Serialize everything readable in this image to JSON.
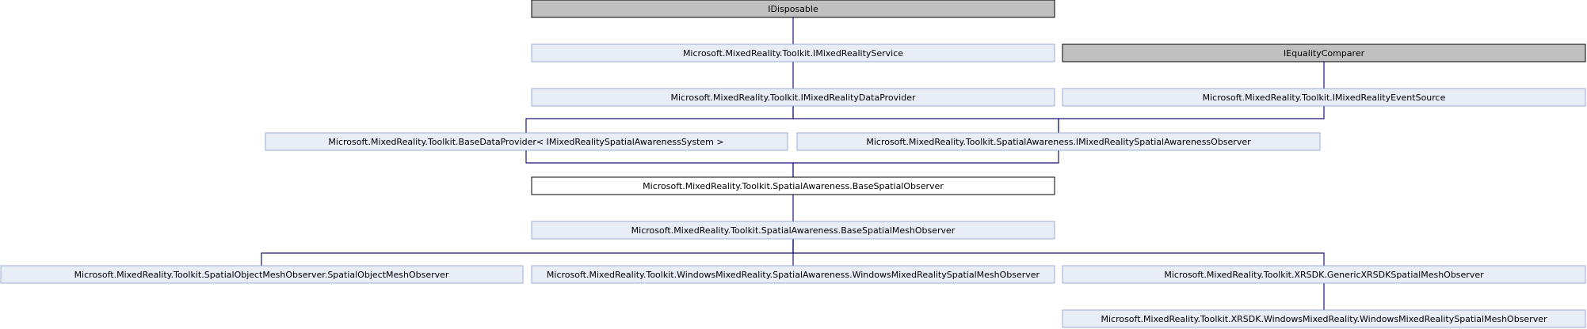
{
  "colors": {
    "external_fill": "#c0c0c0",
    "external_stroke": "#000000",
    "class_fill": "#e8edf7",
    "class_stroke": "#9aafd6",
    "focus_fill": "#ffffff",
    "focus_stroke": "#000000",
    "edge": "#191970"
  },
  "nodes": {
    "idisposable": "IDisposable",
    "imixedrealityservice": "Microsoft.MixedReality.Toolkit.IMixedRealityService",
    "iequalitycomparer": "IEqualityComparer",
    "imixedrealitydataprovider": "Microsoft.MixedReality.Toolkit.IMixedRealityDataProvider",
    "imixedrealityeventsource": "Microsoft.MixedReality.Toolkit.IMixedRealityEventSource",
    "basedataprovider": "Microsoft.MixedReality.Toolkit.BaseDataProvider< IMixedRealitySpatialAwarenessSystem >",
    "ispatialawarenessobserver": "Microsoft.MixedReality.Toolkit.SpatialAwareness.IMixedRealitySpatialAwarenessObserver",
    "basespatialobserver": "Microsoft.MixedReality.Toolkit.SpatialAwareness.BaseSpatialObserver",
    "basespatialmeshobserver": "Microsoft.MixedReality.Toolkit.SpatialAwareness.BaseSpatialMeshObserver",
    "spatialobjectmeshobserver": "Microsoft.MixedReality.Toolkit.SpatialObjectMeshObserver.SpatialObjectMeshObserver",
    "wmr_spatialmeshobserver": "Microsoft.MixedReality.Toolkit.WindowsMixedReality.SpatialAwareness.WindowsMixedRealitySpatialMeshObserver",
    "genericxrsdkspatialmeshobserver": "Microsoft.MixedReality.Toolkit.XRSDK.GenericXRSDKSpatialMeshObserver",
    "xrsdk_wmr_spatialmeshobserver": "Microsoft.MixedReality.Toolkit.XRSDK.WindowsMixedReality.WindowsMixedRealitySpatialMeshObserver"
  }
}
